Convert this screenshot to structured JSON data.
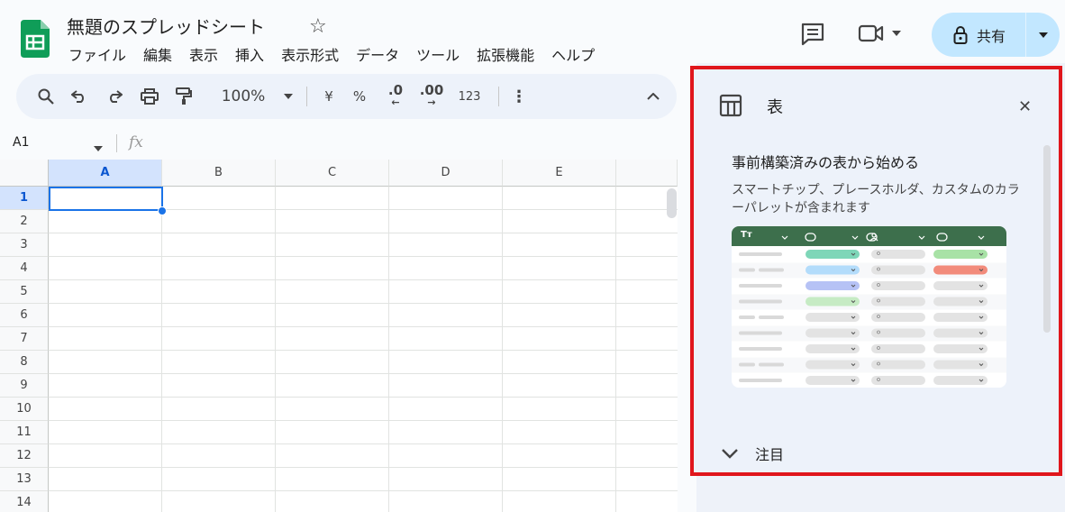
{
  "header": {
    "doc_title": "無題のスプレッドシート",
    "menu": [
      "ファイル",
      "編集",
      "表示",
      "挿入",
      "表示形式",
      "データ",
      "ツール",
      "拡張機能",
      "ヘルプ"
    ],
    "share_label": "共有"
  },
  "toolbar": {
    "zoom": "100%",
    "currency": "¥",
    "percent": "%",
    "dec_decrease": ".0",
    "dec_increase": ".00",
    "number_format": "123"
  },
  "formula_bar": {
    "cell_ref": "A1",
    "fx": "fx"
  },
  "grid": {
    "columns": [
      "A",
      "B",
      "C",
      "D",
      "E"
    ],
    "rows": [
      "1",
      "2",
      "3",
      "4",
      "5",
      "6",
      "7",
      "8",
      "9",
      "10",
      "11",
      "12",
      "13",
      "14"
    ],
    "selected_cell": "A1"
  },
  "side_panel": {
    "title": "表",
    "card_title": "事前構築済みの表から始める",
    "card_description": "スマートチップ、プレースホルダ、カスタムのカラーパレットが含まれます",
    "preview_header_tt": "Tт",
    "notes_label": "注目"
  },
  "colors": {
    "accent": "#1a73e8",
    "share_bg": "#c2e7ff",
    "highlight_border": "#e0161c",
    "sheets_green": "#0f9d58",
    "preview_header": "#3d6f4c"
  }
}
